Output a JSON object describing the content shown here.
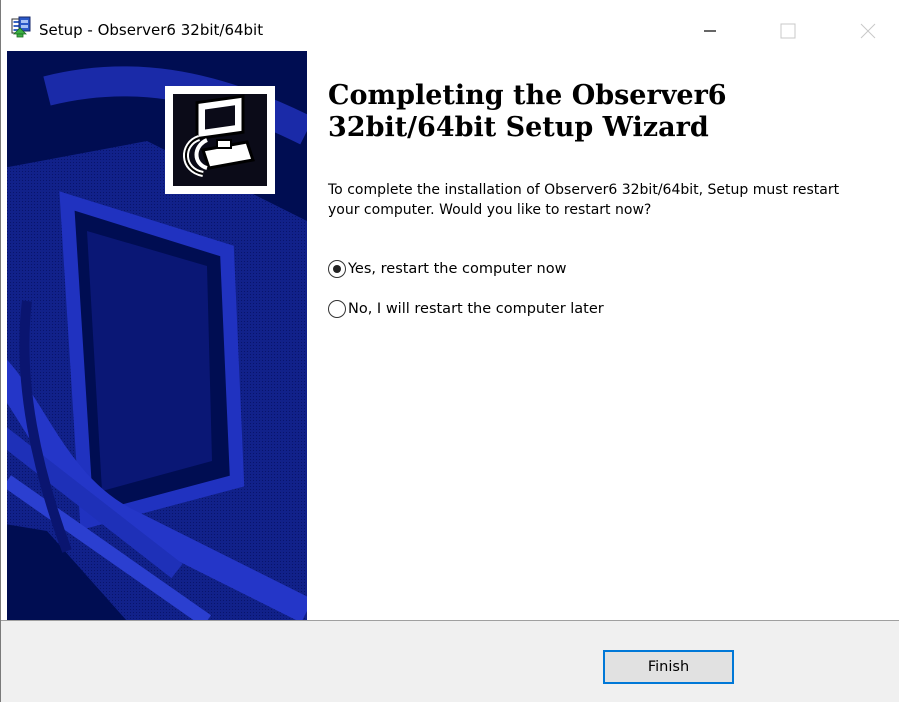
{
  "window": {
    "title": "Setup - Observer6 32bit/64bit",
    "icon": "installer-icon",
    "controls": [
      "minimize-icon",
      "maximize-icon",
      "close-icon"
    ]
  },
  "wizard": {
    "heading": "Completing the Observer6 32bit/64bit Setup Wizard",
    "description": "To complete the installation of Observer6 32bit/64bit, Setup must restart your computer. Would you like to restart now?",
    "options": [
      {
        "label": "Yes, restart the computer now",
        "selected": true
      },
      {
        "label": "No, I will restart the computer later",
        "selected": false
      }
    ]
  },
  "footer": {
    "finish_label": "Finish"
  },
  "colors": {
    "banner": "#000d52",
    "banner_art": "#1a2db8",
    "focus": "#0078d7",
    "footer": "#f0f0f0"
  }
}
